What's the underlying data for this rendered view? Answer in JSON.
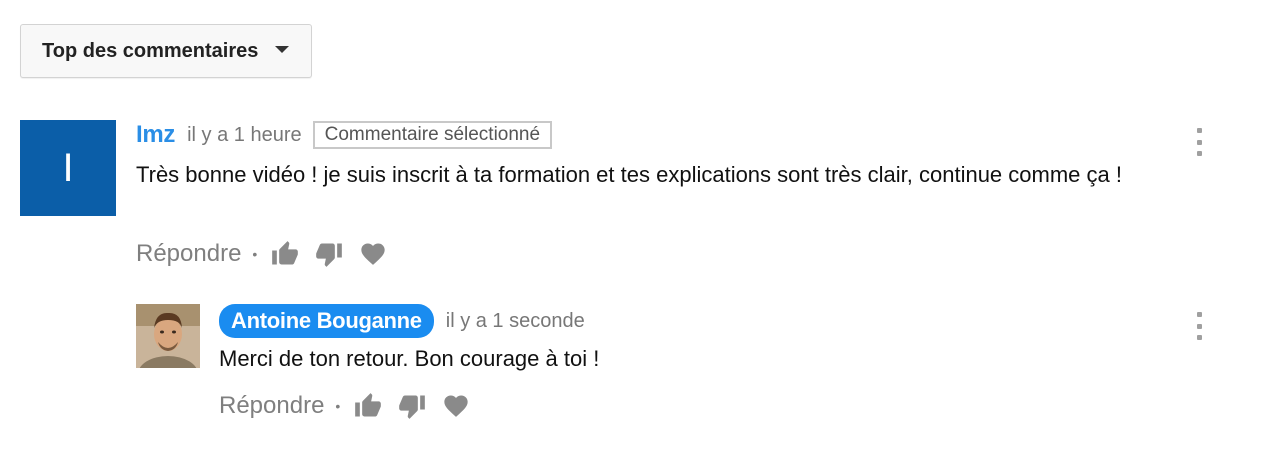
{
  "sort": {
    "label": "Top des commentaires",
    "icon": "caret-down-icon"
  },
  "comments": [
    {
      "author": "Imz",
      "avatar_letter": "I",
      "avatar_color": "#0b5ea8",
      "time": "il y a 1 heure",
      "badge": "Commentaire sélectionné",
      "text": "Très bonne vidéo ! je suis inscrit à ta formation et tes explications sont très clair, continue comme ça !",
      "reply_label": "Répondre",
      "separator": "•"
    }
  ],
  "replies": [
    {
      "author": "Antoine Bouganne",
      "author_badge_color": "#1a8cf0",
      "time": "il y a 1 seconde",
      "text": "Merci de ton retour. Bon courage à toi !",
      "reply_label": "Répondre",
      "separator": "•"
    }
  ],
  "icons": {
    "like": "thumbs-up-icon",
    "dislike": "thumbs-down-icon",
    "heart": "heart-icon",
    "menu": "more-vertical-icon"
  }
}
